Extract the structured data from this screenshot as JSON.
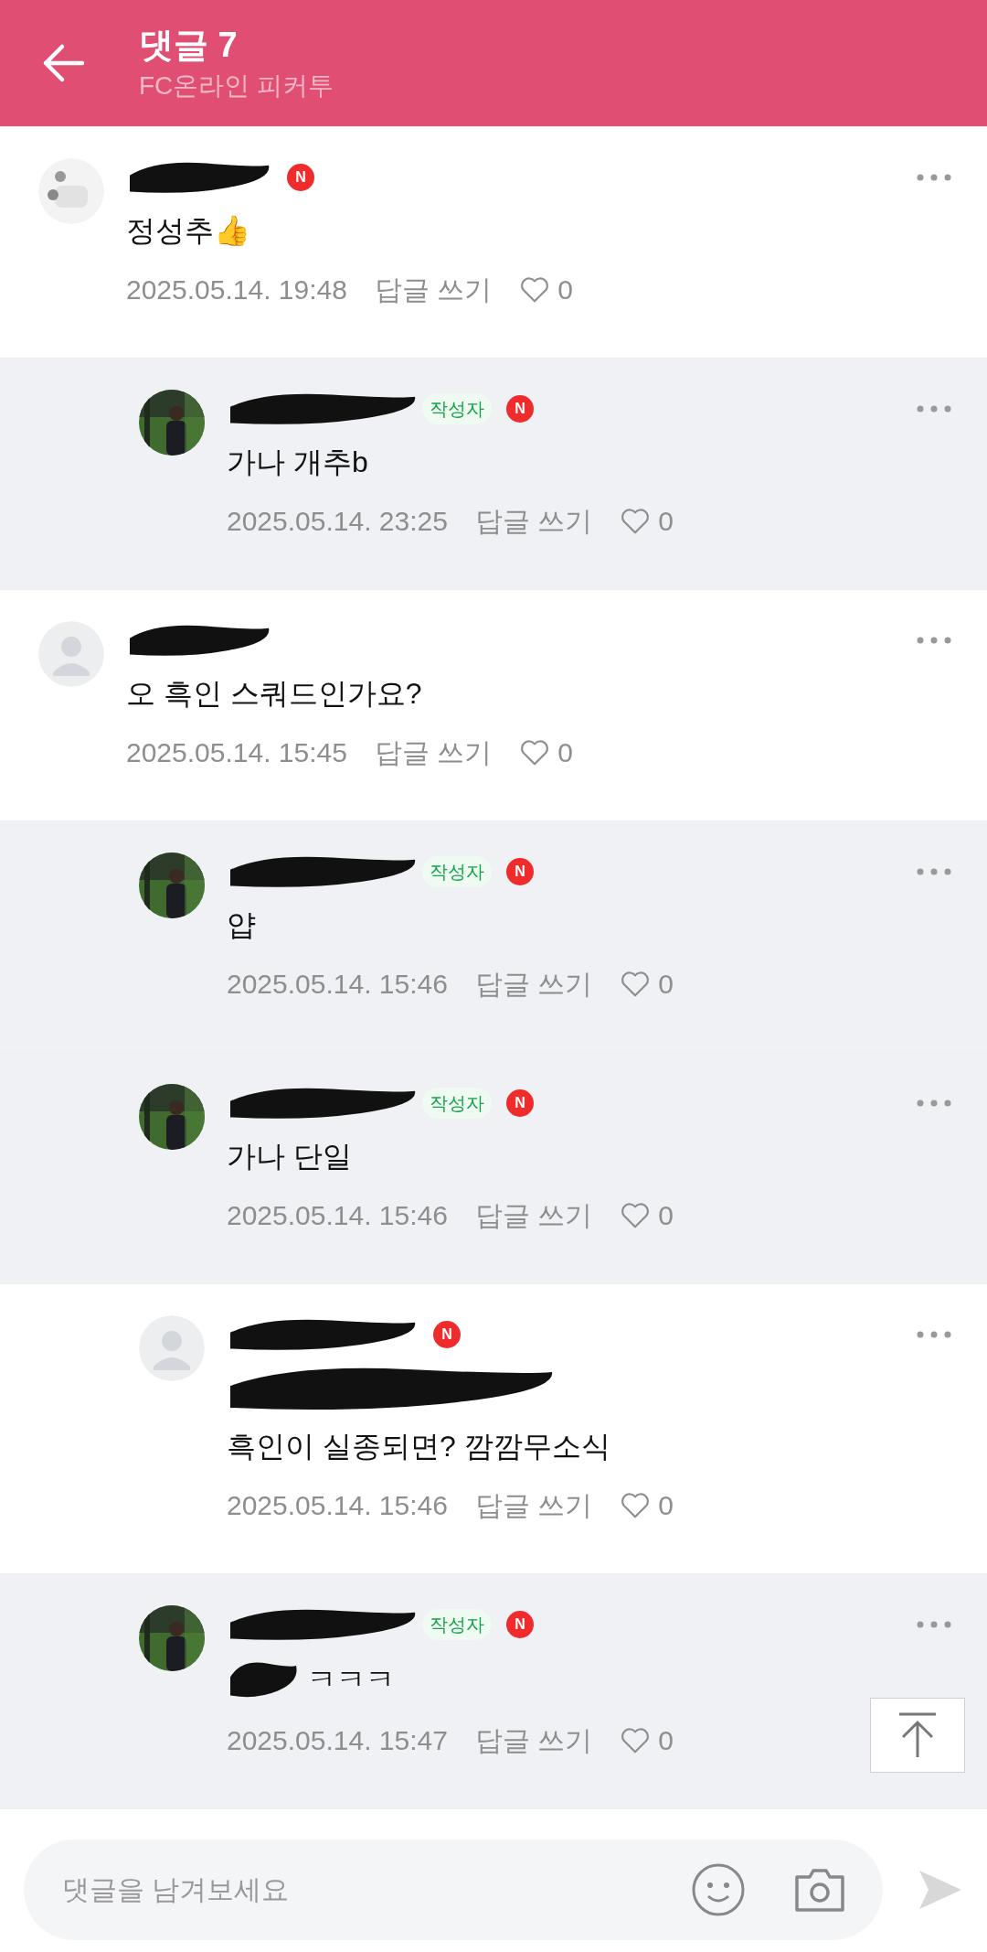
{
  "header": {
    "title": "댓글 7",
    "subtitle": "FC온라인 피커투"
  },
  "comments": [
    {
      "kind": "comment",
      "avatar": {
        "kind": "doodle"
      },
      "highlighted": false,
      "badges": [
        {
          "kind": "new",
          "text": "N"
        }
      ],
      "text": "정성추👍",
      "date": "2025.05.14. 19:48",
      "reply": "답글 쓰기",
      "likes": "0"
    },
    {
      "kind": "reply",
      "highlighted": true,
      "badges": [
        {
          "kind": "writer",
          "text": "작성자"
        },
        {
          "kind": "new",
          "text": "N"
        }
      ],
      "text": "가나 개추b",
      "date": "2025.05.14. 23:25",
      "reply": "답글 쓰기",
      "likes": "0"
    },
    {
      "kind": "comment",
      "avatar": {
        "kind": "default"
      },
      "highlighted": false,
      "text": "오 흑인 스쿼드인가요?",
      "date": "2025.05.14. 15:45",
      "reply": "답글 쓰기",
      "likes": "0"
    },
    {
      "kind": "reply",
      "highlighted": true,
      "badges": [
        {
          "kind": "writer",
          "text": "작성자"
        },
        {
          "kind": "new",
          "text": "N"
        }
      ],
      "text": "얍",
      "date": "2025.05.14. 15:46",
      "reply": "답글 쓰기",
      "likes": "0"
    },
    {
      "kind": "reply",
      "highlighted": true,
      "badges": [
        {
          "kind": "writer",
          "text": "작성자"
        },
        {
          "kind": "new",
          "text": "N"
        }
      ],
      "text": "가나 단일",
      "date": "2025.05.14. 15:46",
      "reply": "답글 쓰기",
      "likes": "0"
    },
    {
      "kind": "reply",
      "avatar": {
        "kind": "default"
      },
      "highlighted": false,
      "badges": [
        {
          "kind": "new",
          "text": "N"
        }
      ],
      "mention_hidden": true,
      "text": "흑인이 실종되면? 깜깜무소식",
      "date": "2025.05.14. 15:46",
      "reply": "답글 쓰기",
      "likes": "0"
    },
    {
      "kind": "reply",
      "highlighted": true,
      "badges": [
        {
          "kind": "writer",
          "text": "작성자"
        },
        {
          "kind": "new",
          "text": "N"
        }
      ],
      "inline_mention_hidden": true,
      "text": "ㅋㅋㅋ",
      "date": "2025.05.14. 15:47",
      "reply": "답글 쓰기",
      "likes": "0"
    }
  ],
  "composer": {
    "placeholder": "댓글을 남겨보세요"
  }
}
